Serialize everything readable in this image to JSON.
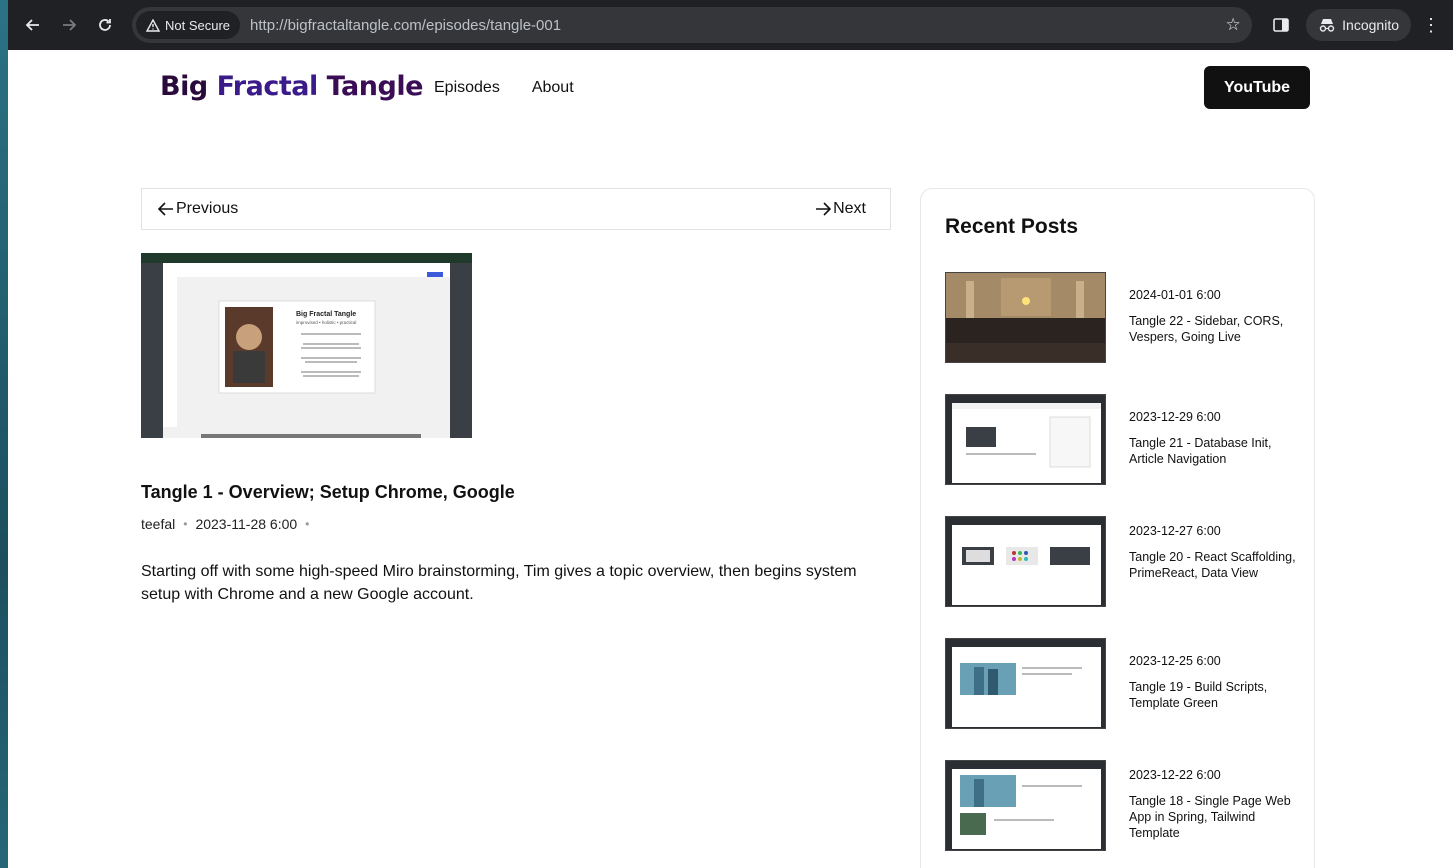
{
  "browser": {
    "security_label": "Not Secure",
    "url": "http://bigfractaltangle.com/episodes/tangle-001",
    "profile_label": "Incognito"
  },
  "site": {
    "logo": {
      "word1": "Big",
      "word2": "Fractal",
      "word3": "Tangle"
    },
    "nav": [
      {
        "label": "Episodes"
      },
      {
        "label": "About"
      }
    ],
    "cta_label": "YouTube"
  },
  "article": {
    "prev_label": "Previous",
    "next_label": "Next",
    "thumbnail": {
      "card_title": "Big Fractal Tangle",
      "card_subtitle": "improvised • holistic • practical"
    },
    "title": "Tangle 1 - Overview; Setup Chrome, Google",
    "author": "teefal",
    "date": "2023-11-28 6:00",
    "excerpt": "Starting off with some high-speed Miro brainstorming, Tim gives a topic overview, then begins system setup with Chrome and a new Google account."
  },
  "sidebar": {
    "title": "Recent Posts",
    "posts": [
      {
        "date": "2024-01-01 6:00",
        "title": "Tangle 22 - Sidebar, CORS, Vespers, Going Live"
      },
      {
        "date": "2023-12-29 6:00",
        "title": "Tangle 21 - Database Init, Article Navigation"
      },
      {
        "date": "2023-12-27 6:00",
        "title": "Tangle 20 - React Scaffolding, PrimeReact, Data View"
      },
      {
        "date": "2023-12-25 6:00",
        "title": "Tangle 19 - Build Scripts, Template Green"
      },
      {
        "date": "2023-12-22 6:00",
        "title": "Tangle 18 - Single Page Web App in Spring, Tailwind Template"
      }
    ]
  },
  "colors": {
    "chrome_bg": "#202124",
    "omnibox_bg": "#35363a",
    "cta_bg": "#111111",
    "logo_purple": "#3b1a8a"
  }
}
